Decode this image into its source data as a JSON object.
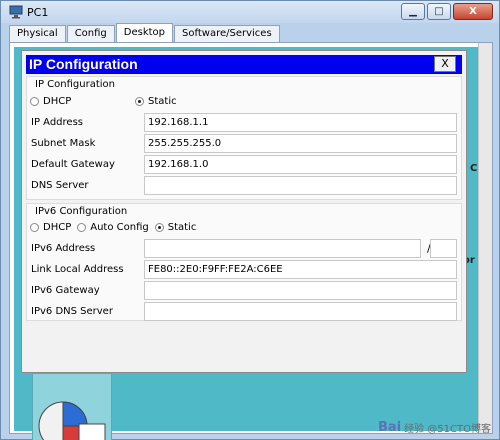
{
  "window": {
    "title": "PC1",
    "minimize_glyph": "▁",
    "maximize_glyph": "□",
    "close_glyph": "X"
  },
  "tabs": [
    {
      "label": "Physical"
    },
    {
      "label": "Config"
    },
    {
      "label": "Desktop",
      "active": true
    },
    {
      "label": "Software/Services"
    }
  ],
  "background": {
    "partial_label_1": "C",
    "partial_label_2": "or"
  },
  "dialog": {
    "title": "IP Configuration",
    "close_label": "X",
    "ipv4": {
      "group_title": "IP Configuration",
      "mode_options": [
        {
          "label": "DHCP",
          "selected": false
        },
        {
          "label": "Static",
          "selected": true
        }
      ],
      "fields": [
        {
          "label": "IP Address",
          "value": "192.168.1.1"
        },
        {
          "label": "Subnet Mask",
          "value": "255.255.255.0"
        },
        {
          "label": "Default Gateway",
          "value": "192.168.1.0"
        },
        {
          "label": "DNS Server",
          "value": ""
        }
      ]
    },
    "ipv6": {
      "group_title": "IPv6 Configuration",
      "mode_options": [
        {
          "label": "DHCP",
          "selected": false
        },
        {
          "label": "Auto Config",
          "selected": false
        },
        {
          "label": "Static",
          "selected": true
        }
      ],
      "address": {
        "label": "IPv6 Address",
        "value": "",
        "slash": "/",
        "prefix": ""
      },
      "link_local": {
        "label": "Link Local Address",
        "value": "FE80::2E0:F9FF:FE2A:C6EE"
      },
      "gateway": {
        "label": "IPv6 Gateway",
        "value": ""
      },
      "dns": {
        "label": "IPv6 DNS Server",
        "value": ""
      }
    }
  },
  "watermark": {
    "logo_text": "Bai",
    "text": "经验 @51CTO博客"
  },
  "colors": {
    "dialog_header": "#0000ee",
    "desktop_bg": "#4fb9c7"
  }
}
